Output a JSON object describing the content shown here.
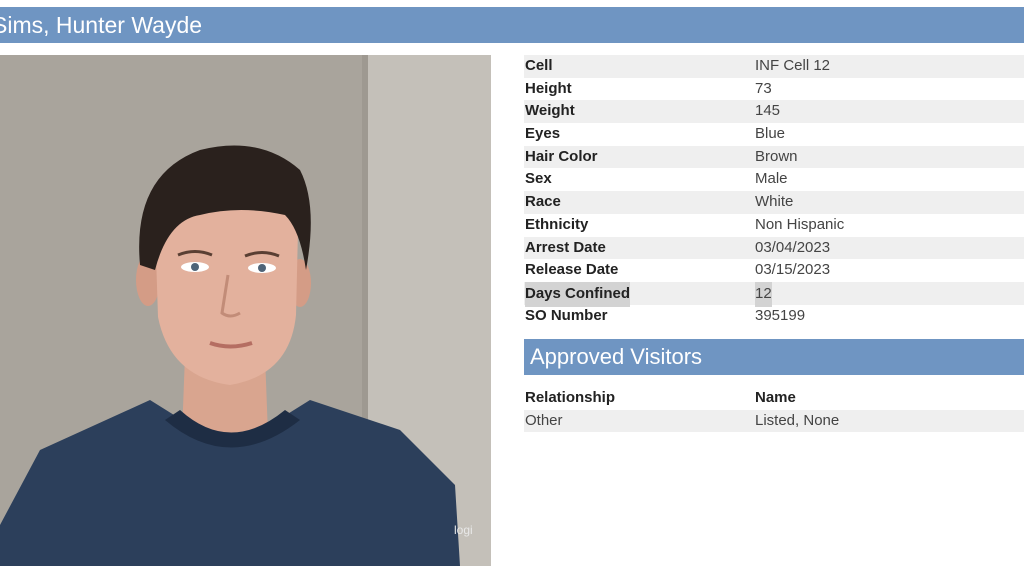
{
  "header": {
    "name": "Sims, Hunter Wayde"
  },
  "photo": {
    "watermark": "logi"
  },
  "details": [
    {
      "label": "Cell",
      "value": "INF Cell 12"
    },
    {
      "label": "Height",
      "value": "73"
    },
    {
      "label": "Weight",
      "value": "145"
    },
    {
      "label": "Eyes",
      "value": "Blue"
    },
    {
      "label": "Hair Color",
      "value": "Brown"
    },
    {
      "label": "Sex",
      "value": "Male"
    },
    {
      "label": "Race",
      "value": "White"
    },
    {
      "label": "Ethnicity",
      "value": "Non Hispanic"
    },
    {
      "label": "Arrest Date",
      "value": "03/04/2023"
    },
    {
      "label": "Release Date",
      "value": "03/15/2023"
    },
    {
      "label": "Days Confined",
      "value": "12"
    },
    {
      "label": "SO Number",
      "value": "395199"
    }
  ],
  "visitors": {
    "title": "Approved Visitors",
    "columns": [
      "Relationship",
      "Name"
    ],
    "rows": [
      [
        "Other",
        "Listed, None"
      ]
    ]
  },
  "colors": {
    "header_bg": "#6f95c2",
    "row_shade": "#efefef",
    "highlight": "#d3d3d3"
  }
}
